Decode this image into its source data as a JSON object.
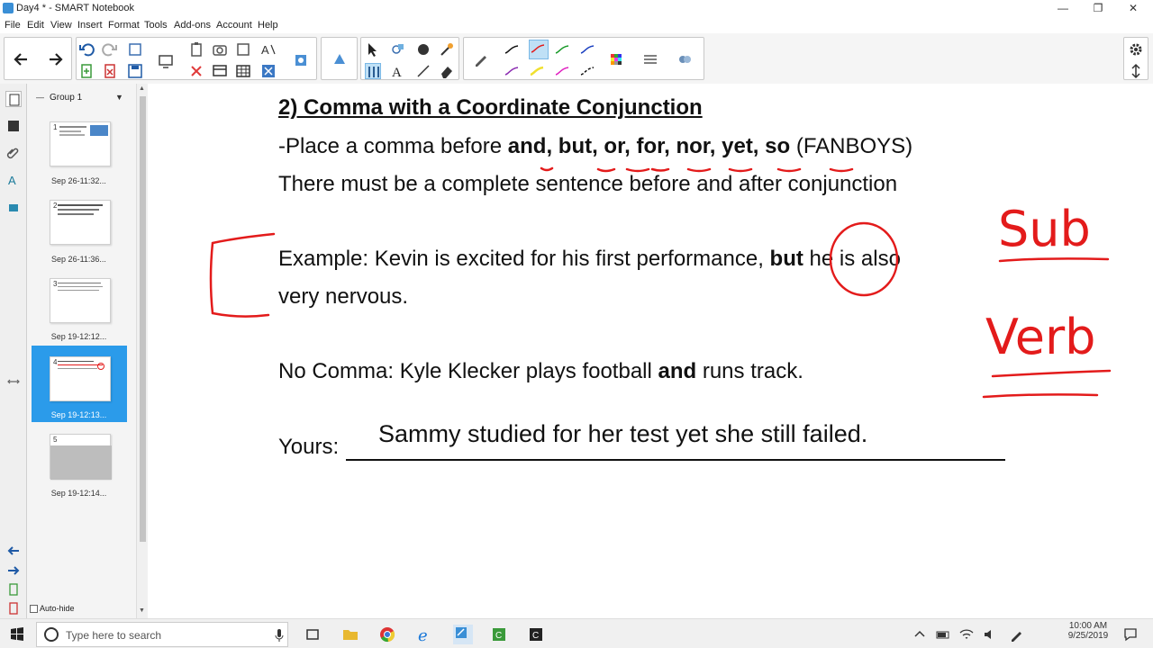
{
  "window": {
    "title": "Day4 * - SMART Notebook",
    "minimize": "—",
    "maximize": "❐",
    "close": "✕"
  },
  "menu": [
    "File",
    "Edit",
    "View",
    "Insert",
    "Format",
    "Tools",
    "Add-ons",
    "Account",
    "Help"
  ],
  "sidebar": {
    "group_label": "Group 1",
    "pages": [
      {
        "num": "1",
        "date": "Sep 26-11:32..."
      },
      {
        "num": "2",
        "date": "Sep 26-11:36..."
      },
      {
        "num": "3",
        "date": "Sep 19-12:12..."
      },
      {
        "num": "4",
        "date": "Sep 19-12:13...",
        "selected": true
      },
      {
        "num": "5",
        "date": "Sep 19-12:14..."
      }
    ],
    "autohide": "Auto-hide"
  },
  "page": {
    "heading": "2) Comma with a Coordinate Conjunction",
    "line1_prefix": "-Place a comma before ",
    "line1_bold": "and, but, or, for, nor, yet, so",
    "line1_suffix": " (FANBOYS)",
    "line2": "There must be a complete sentence before and after conjunction",
    "example_prefix": "Example: Kevin is excited for his first performance, ",
    "example_bold": "but",
    "example_suffix": " he is also",
    "example_line2": "very nervous.",
    "nocomma_prefix": "No Comma: Kyle Klecker plays football ",
    "nocomma_bold": "and",
    "nocomma_suffix": " runs track.",
    "yours_label": "Yours:",
    "yours_text": "Sammy studied for her test yet she still failed.",
    "ink_sub": "Sub",
    "ink_verb": "Verb"
  },
  "taskbar": {
    "search_placeholder": "Type here to search",
    "time": "10:00 AM",
    "date": "9/25/2019"
  },
  "colors": {
    "ink_red": "#e31b1b",
    "selected_page": "#2b9bea"
  }
}
